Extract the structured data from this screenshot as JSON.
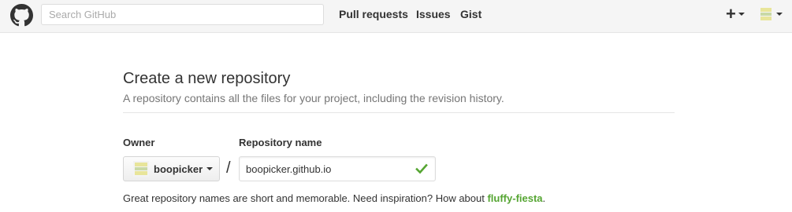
{
  "header": {
    "search_placeholder": "Search GitHub",
    "nav": [
      {
        "label": "Pull requests"
      },
      {
        "label": "Issues"
      },
      {
        "label": "Gist"
      }
    ],
    "new_menu_icon": "plus",
    "user_menu_icon": "avatar"
  },
  "page": {
    "title": "Create a new repository",
    "subtitle": "A repository contains all the files for your project, including the revision history."
  },
  "form": {
    "owner_label": "Owner",
    "owner_value": "boopicker",
    "separator": "/",
    "repo_label": "Repository name",
    "repo_value": "boopicker.github.io",
    "repo_valid_icon": "check-icon"
  },
  "hint": {
    "text": "Great repository names are short and memorable. Need inspiration? How about ",
    "suggestion": "fluffy-fiesta",
    "end": "."
  },
  "colors": {
    "header_bg": "#f5f5f5",
    "valid_green": "#55a532",
    "avatar_yellow": "#e8e59a",
    "avatar_green": "#c9d9a6"
  }
}
